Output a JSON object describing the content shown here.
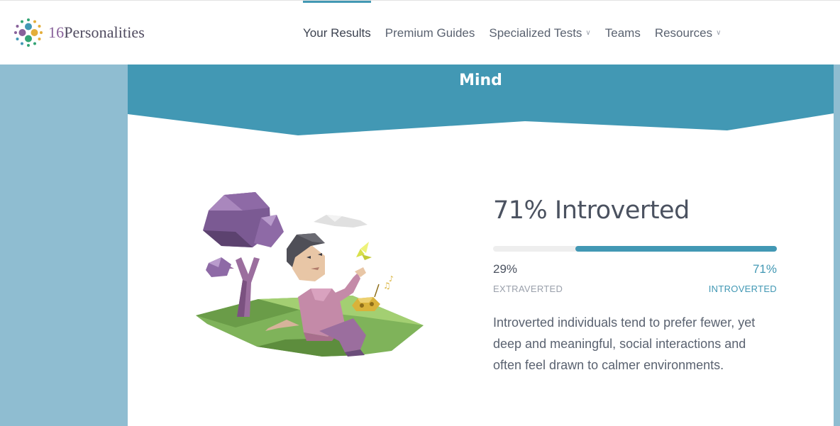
{
  "header": {
    "logo": {
      "number": "16",
      "word": "Personalities"
    },
    "nav": [
      {
        "label": "Your Results",
        "active": true,
        "dropdown": false
      },
      {
        "label": "Premium Guides",
        "active": false,
        "dropdown": false
      },
      {
        "label": "Specialized Tests",
        "active": false,
        "dropdown": true
      },
      {
        "label": "Teams",
        "active": false,
        "dropdown": false
      },
      {
        "label": "Resources",
        "active": false,
        "dropdown": true
      }
    ]
  },
  "section": {
    "title": "Mind",
    "result_heading": "71% Introverted",
    "bar": {
      "left_fraction": 0.29,
      "right_fraction": 0.71
    },
    "left_percent": "29%",
    "right_percent": "71%",
    "left_trait": "EXTRAVERTED",
    "right_trait": "INTROVERTED",
    "description": "Introverted individuals tend to prefer fewer, yet deep and meaningful, social interactions and often feel drawn to calmer environments."
  },
  "colors": {
    "accent": "#4298b4",
    "page_background": "#8fbdd1",
    "tree_purple": "#88619a",
    "grass_green": "#7fb35a"
  },
  "icons": {
    "logo": "sixteen-personalities-logo",
    "chevron": "chevron-down-icon",
    "illustration": "introvert-reading-under-tree-illustration"
  }
}
